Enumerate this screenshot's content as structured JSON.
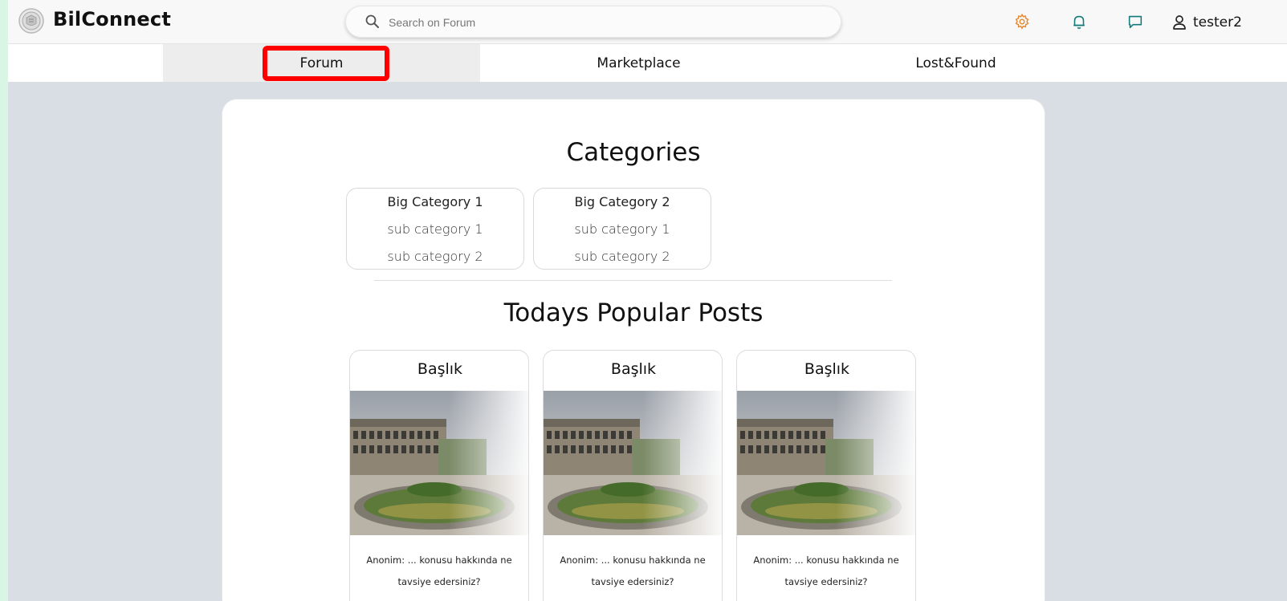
{
  "header": {
    "brand": "BilConnect",
    "search_placeholder": "Search on Forum",
    "username": "tester2"
  },
  "icons": {
    "logo": "university-seal-icon",
    "search": "search-icon",
    "settings": "gear-icon",
    "notifications": "bell-icon",
    "messages": "chat-icon",
    "user": "user-icon"
  },
  "colors": {
    "settings_icon": "#e8892f",
    "teal_icon": "#137a7a",
    "highlight": "#ff0000",
    "page_bg": "#d9dde4"
  },
  "tabs": [
    {
      "label": "Forum",
      "active": true
    },
    {
      "label": "Marketplace",
      "active": false
    },
    {
      "label": "Lost&Found",
      "active": false
    }
  ],
  "categories": {
    "title": "Categories",
    "groups": [
      {
        "name": "Big Category 1",
        "subs": [
          "sub category 1",
          "sub category 2"
        ]
      },
      {
        "name": "Big Category 2",
        "subs": [
          "sub category 1",
          "sub category 2"
        ]
      }
    ]
  },
  "popular": {
    "title": "Todays Popular Posts",
    "posts": [
      {
        "title": "Başlık",
        "text": "Anonim: ... konusu hakkında ne tavsiye edersiniz?"
      },
      {
        "title": "Başlık",
        "text": "Anonim: ... konusu hakkında ne tavsiye edersiniz?"
      },
      {
        "title": "Başlık",
        "text": "Anonim: ... konusu hakkında ne tavsiye edersiniz?"
      }
    ]
  }
}
